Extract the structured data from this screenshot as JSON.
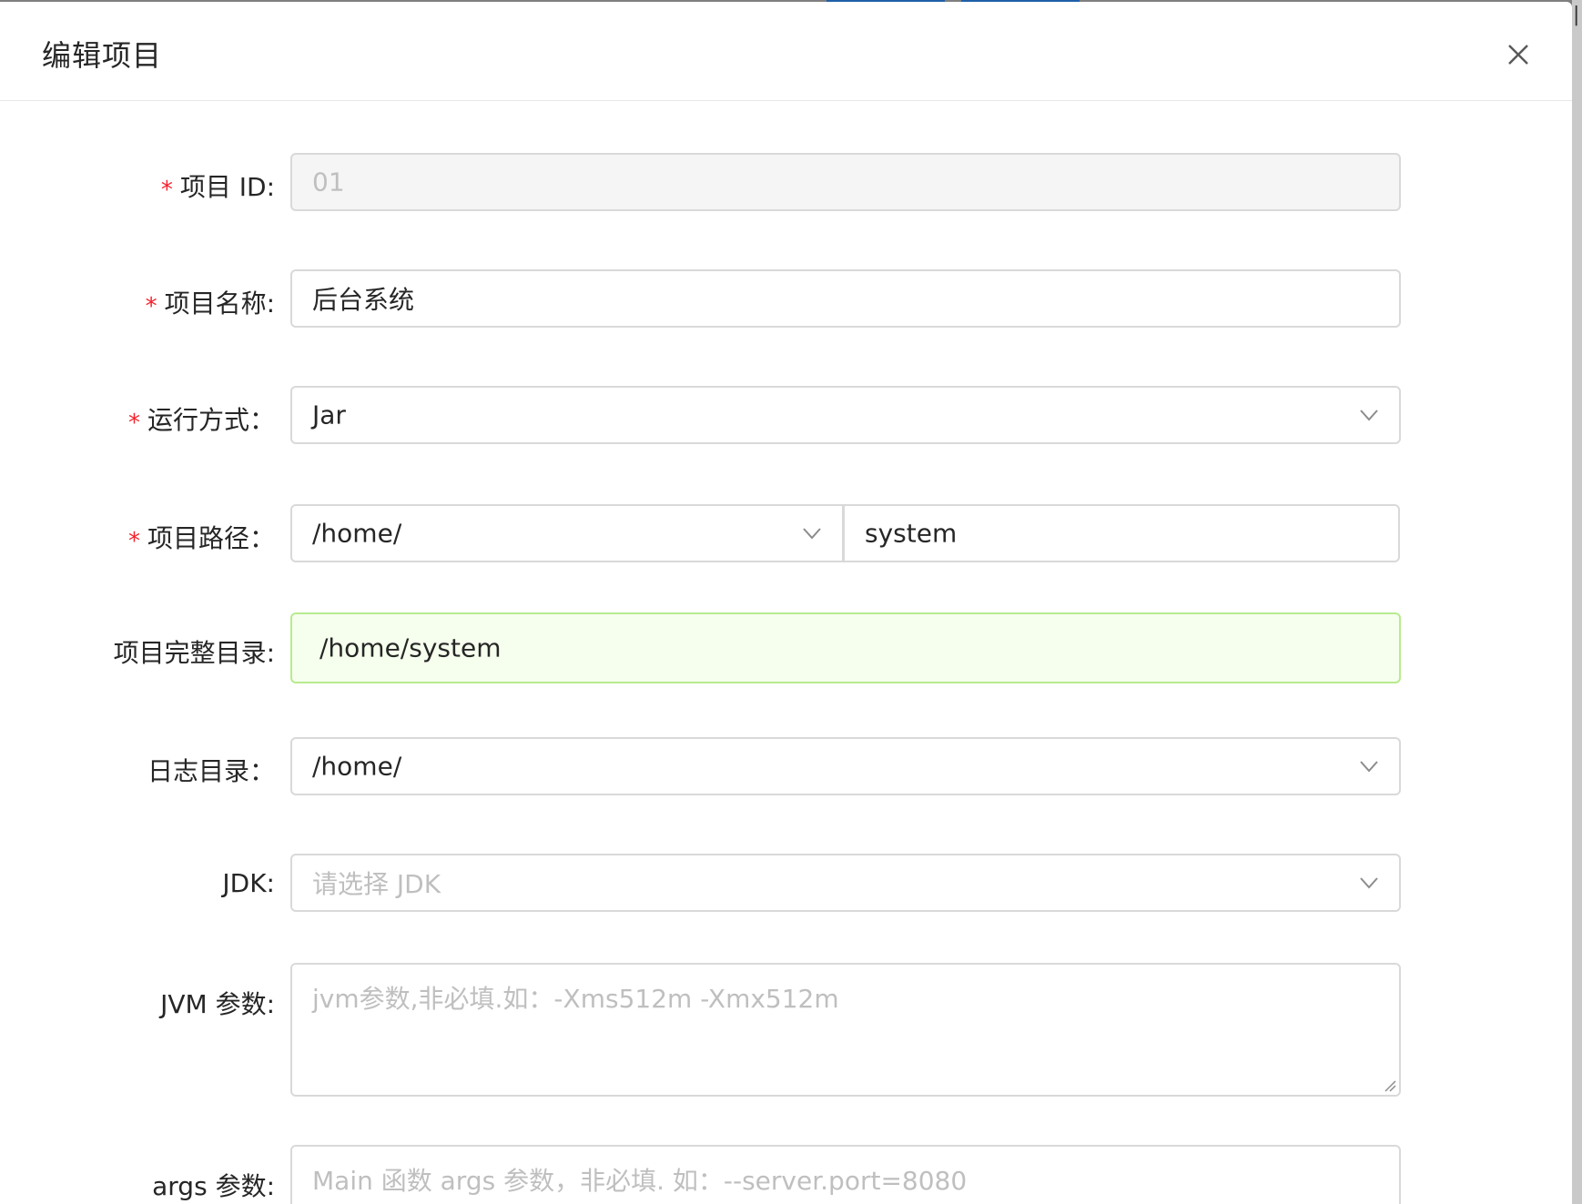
{
  "modal": {
    "title": "编辑项目",
    "close_icon": "close-icon"
  },
  "form": {
    "project_id": {
      "label": "项目 ID:",
      "value": "01",
      "required": true,
      "disabled": true
    },
    "project_name": {
      "label": "项目名称:",
      "value": "后台系统",
      "required": true
    },
    "run_mode": {
      "label": "运行方式：",
      "value": "Jar",
      "required": true,
      "icon": "chevron-down-icon"
    },
    "project_path": {
      "label": "项目路径：",
      "dir_value": "/home/",
      "sub_value": "system",
      "required": true,
      "icon": "chevron-down-icon"
    },
    "full_dir": {
      "label": "项目完整目录:",
      "value": "/home/system"
    },
    "log_dir": {
      "label": "日志目录：",
      "value": "/home/",
      "icon": "chevron-down-icon"
    },
    "jdk": {
      "label": "JDK:",
      "placeholder": "请选择 JDK",
      "icon": "chevron-down-icon"
    },
    "jvm_args": {
      "label": "JVM 参数:",
      "placeholder": "jvm参数,非必填.如：-Xms512m -Xmx512m"
    },
    "main_args": {
      "label": "args 参数:",
      "placeholder": "Main 函数 args 参数，非必填. 如：--server.port=8080"
    }
  },
  "required_marker": "*",
  "colors": {
    "required": "#f5222d",
    "border": "#d9d9d9",
    "disabled_bg": "#f5f5f5",
    "success_bg": "#f6ffed",
    "success_border": "#b7eb8f",
    "placeholder": "#bfbfbf"
  }
}
